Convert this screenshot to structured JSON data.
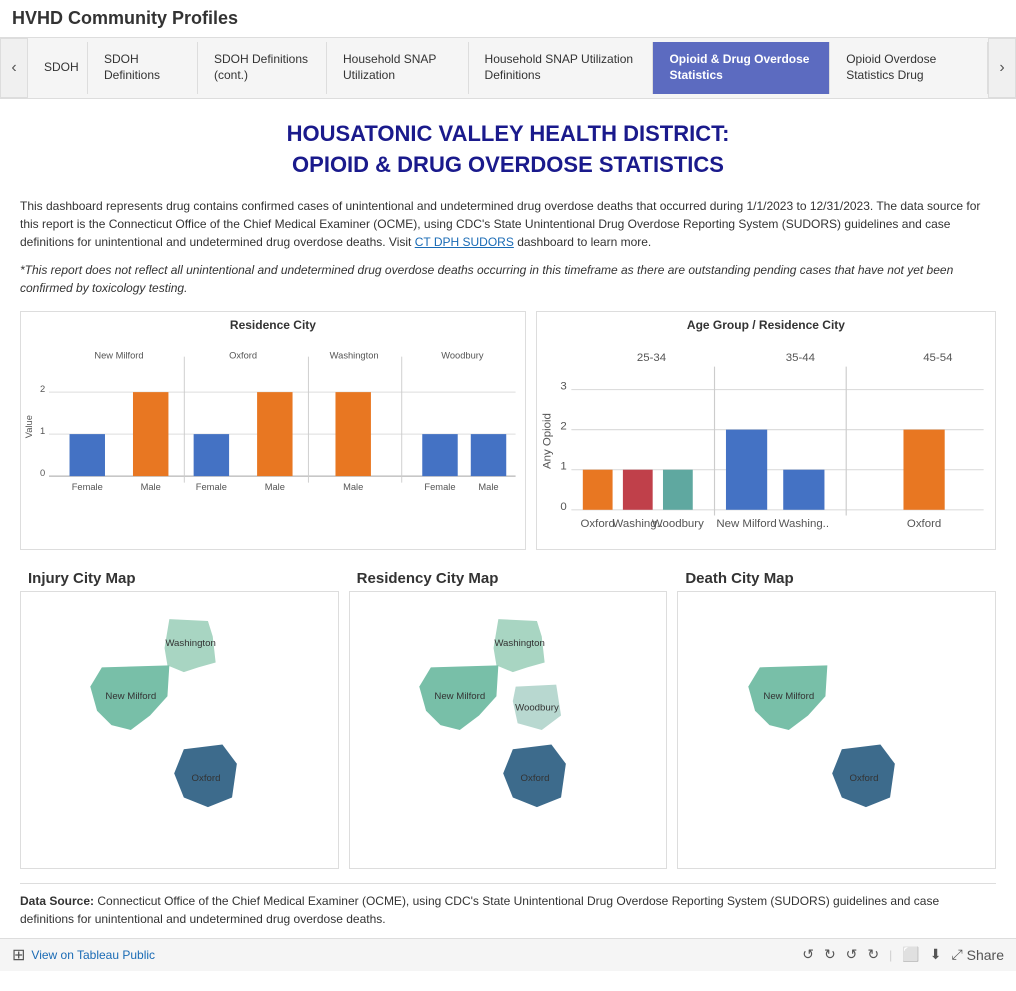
{
  "app": {
    "title": "HVHD Community Profiles"
  },
  "tabs": [
    {
      "id": "sdoh",
      "label": "SDOH",
      "active": false,
      "partial": true
    },
    {
      "id": "sdoh-definitions",
      "label": "SDOH Definitions",
      "active": false
    },
    {
      "id": "sdoh-definitions-cont",
      "label": "SDOH Definitions (cont.)",
      "active": false
    },
    {
      "id": "household-snap",
      "label": "Household SNAP Utilization",
      "active": false
    },
    {
      "id": "household-snap-def",
      "label": "Household SNAP Utilization Definitions",
      "active": false
    },
    {
      "id": "opioid-drug",
      "label": "Opioid & Drug Overdose Statistics",
      "active": true
    },
    {
      "id": "opioid-drug-def",
      "label": "Opioid Overdose Statistics Drug",
      "active": false,
      "partial": true
    }
  ],
  "page": {
    "title_line1": "HOUSATONIC VALLEY HEALTH DISTRICT:",
    "title_line2": "OPIOID & DRUG OVERDOSE STATISTICS",
    "description": "This dashboard represents drug contains confirmed cases of unintentional and undetermined drug overdose deaths that occurred during 1/1/2023 to 12/31/2023. The data source for this report is the Connecticut Office of the Chief Medical Examiner (OCME), using CDC's State Unintentional Drug Overdose Reporting System (SUDORS) guidelines and case definitions for unintentional and undetermined drug overdose deaths. Visit",
    "description_link": "CT DPH SUDORS",
    "description_link_suffix": "dashboard to learn more.",
    "note": "*This report does not reflect all unintentional and undetermined drug overdose deaths occurring in this timeframe as there are outstanding pending cases that have not yet been confirmed by toxicology testing.",
    "chart1_title": "Residence City",
    "chart2_title": "Age Group / Residence City",
    "chart2_y_label": "Any Opioid",
    "map1_title": "Injury City Map",
    "map2_title": "Residency City Map",
    "map3_title": "Death City Map",
    "data_source_label": "Data Source:",
    "data_source_text": "Connecticut Office of the Chief Medical Examiner (OCME), using CDC's State Unintentional Drug Overdose Reporting System (SUDORS) guidelines and case definitions for unintentional and undetermined drug overdose deaths.",
    "footer_link": "View on Tableau Public",
    "footer_share": "Share"
  },
  "bar_chart1": {
    "groups": [
      {
        "city": "New Milford",
        "bars": [
          {
            "label": "Female",
            "value": 1,
            "color": "#4472c4"
          },
          {
            "label": "Male",
            "value": 2,
            "color": "#e87722"
          }
        ]
      },
      {
        "city": "Oxford",
        "bars": [
          {
            "label": "Female",
            "value": 1,
            "color": "#4472c4"
          },
          {
            "label": "Male",
            "value": 2,
            "color": "#e87722"
          }
        ]
      },
      {
        "city": "Washington",
        "bars": [
          {
            "label": "Male",
            "value": 2,
            "color": "#e87722"
          }
        ]
      },
      {
        "city": "Woodbury",
        "bars": [
          {
            "label": "Female",
            "value": 1,
            "color": "#4472c4"
          },
          {
            "label": "Male",
            "value": 1,
            "color": "#4472c4"
          }
        ]
      }
    ],
    "y_label": "Value",
    "y_max": 2,
    "y_ticks": [
      0,
      1,
      2
    ]
  },
  "bar_chart2": {
    "age_groups": [
      "25-34",
      "35-44",
      "45-54"
    ],
    "cities": [
      "Oxford",
      "Washing..",
      "Woodbury",
      "New Milford",
      "Washing..",
      "Oxford"
    ],
    "bars": [
      {
        "age": "25-34",
        "city": "Oxford",
        "value": 1,
        "color": "#e87722"
      },
      {
        "age": "25-34",
        "city": "Washing..",
        "value": 1,
        "color": "#d84040"
      },
      {
        "age": "25-34",
        "city": "Woodbury",
        "value": 1,
        "color": "#5fa8a0"
      },
      {
        "age": "35-44",
        "city": "New Milford",
        "value": 2,
        "color": "#4472c4"
      },
      {
        "age": "35-44",
        "city": "Washing..",
        "value": 1,
        "color": "#4472c4"
      },
      {
        "age": "45-54",
        "city": "Oxford",
        "value": 2,
        "color": "#e87722"
      }
    ],
    "y_max": 3,
    "y_ticks": [
      0,
      1,
      2,
      3
    ]
  },
  "maps": {
    "injury": {
      "cities": [
        "Washington",
        "New Milford",
        "Oxford"
      ]
    },
    "residency": {
      "cities": [
        "Washington",
        "New Milford",
        "Woodbury",
        "Oxford"
      ]
    },
    "death": {
      "cities": [
        "New Milford",
        "Oxford"
      ]
    }
  },
  "footer": {
    "view_label": "View on Tableau Public",
    "share_label": "Share",
    "undo_label": "Undo",
    "redo_label": "Redo",
    "revert_label": "Revert",
    "forward_label": "Forward"
  }
}
